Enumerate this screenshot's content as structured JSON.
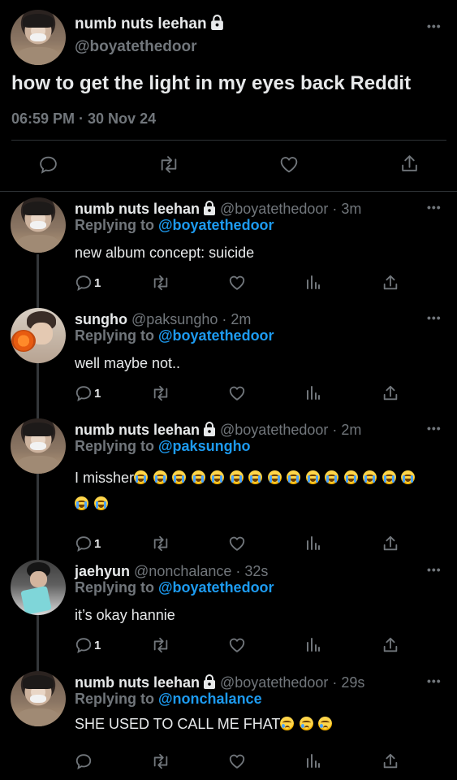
{
  "main_tweet": {
    "display_name": "numb nuts leehan",
    "handle": "@boyatethedoor",
    "text": "how to get the light in my eyes back Reddit",
    "timestamp": "06:59 PM · 30 Nov 24"
  },
  "replies": [
    {
      "display_name": "numb nuts leehan",
      "handle": "@boyatethedoor · 3m",
      "replying_prefix": "Replying to",
      "replying_to": "@boyatethedoor",
      "text": "new album concept: suicide",
      "reply_count": "1",
      "avatar": "leehan"
    },
    {
      "display_name": "sungho",
      "handle": "@paksungho · 2m",
      "replying_prefix": "Replying to",
      "replying_to": "@boyatethedoor",
      "text": "well maybe not..",
      "reply_count": "1",
      "avatar": "sungho"
    },
    {
      "display_name": "numb nuts leehan",
      "handle": "@boyatethedoor · 2m",
      "replying_prefix": "Replying to",
      "replying_to": "@paksungho",
      "text": "I missher",
      "emoji_icon": "loudly-crying-face-icon",
      "emoji_count": 17,
      "reply_count": "1",
      "avatar": "leehan"
    },
    {
      "display_name": "jaehyun",
      "handle": "@nonchalance · 32s",
      "replying_prefix": "Replying to",
      "replying_to": "@boyatethedoor",
      "text": "it’s okay hannie",
      "reply_count": "1",
      "avatar": "jaehyun"
    },
    {
      "display_name": "numb nuts leehan",
      "handle": "@boyatethedoor · 29s",
      "replying_prefix": "Replying to",
      "replying_to": "@nonchalance",
      "text": "SHE USED TO CALL ME FHAT",
      "emoji_icon": "crying-face-icon",
      "emoji_count": 3,
      "reply_count": "",
      "avatar": "leehan"
    }
  ],
  "colors": {
    "background": "#000000",
    "text": "#e7e9ea",
    "secondary": "#71767b",
    "accent": "#1d9bf0",
    "divider": "#2f3336"
  },
  "icons": [
    "lock-icon",
    "more-icon",
    "reply-icon",
    "retweet-icon",
    "like-icon",
    "views-icon",
    "share-icon"
  ]
}
